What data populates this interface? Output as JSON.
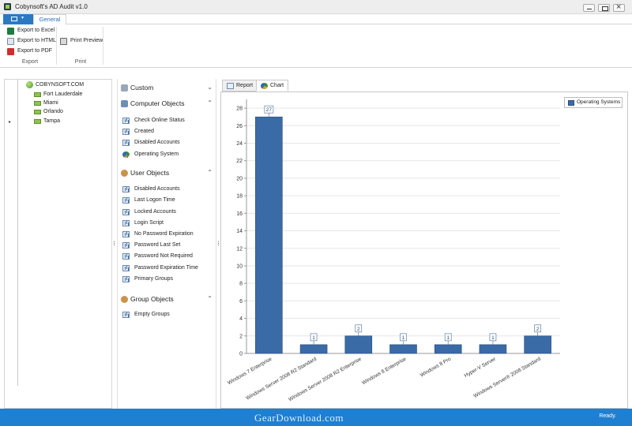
{
  "window": {
    "title": "Cobynsoft's AD Audit v1.0"
  },
  "ribbon": {
    "tab_general": "General",
    "export_group": "Export",
    "print_group": "Print",
    "export_excel": "Export to Excel",
    "export_html": "Export to HTML",
    "export_pdf": "Export to PDF",
    "print_preview": "Print Preview"
  },
  "tree": {
    "root": "COBYNSOFT.COM",
    "children": [
      "Fort Lauderdale",
      "Miami",
      "Orlando",
      "Tampa"
    ]
  },
  "nav": {
    "custom": "Custom",
    "computer_objects": {
      "title": "Computer Objects",
      "items": [
        "Check Online Status",
        "Created",
        "Disabled Accounts",
        "Operating System"
      ]
    },
    "user_objects": {
      "title": "User Objects",
      "items": [
        "Disabled Accounts",
        "Last Logon Time",
        "Locked Accounts",
        "Login Script",
        "No Password Expiration",
        "Password Last Set",
        "Password Not Required",
        "Password Expiration Time",
        "Primary Groups"
      ]
    },
    "group_objects": {
      "title": "Group Objects",
      "items": [
        "Empty Groups"
      ]
    }
  },
  "view_tabs": {
    "report": "Report",
    "chart": "Chart"
  },
  "chart_data": {
    "type": "bar",
    "categories": [
      "Windows 7 Enterprise",
      "Windows Server 2008 R2 Standard",
      "Windows Server 2008 R2 Enterprise",
      "Windows 8 Enterprise",
      "Windows 8 Pro",
      "Hyper-V Server",
      "Windows Server® 2008 Standard"
    ],
    "series": [
      {
        "name": "Operating Systems",
        "values": [
          27,
          1,
          2,
          1,
          1,
          1,
          2
        ]
      }
    ],
    "ylim": [
      0,
      29
    ],
    "yticks": [
      0,
      2,
      4,
      6,
      8,
      10,
      12,
      14,
      16,
      18,
      20,
      22,
      24,
      26,
      28
    ],
    "grid": true,
    "legend_position": "top-right",
    "bar_color": "#3a6ba6"
  },
  "status": {
    "text": "Ready.",
    "watermark": "GearDownload.com"
  }
}
